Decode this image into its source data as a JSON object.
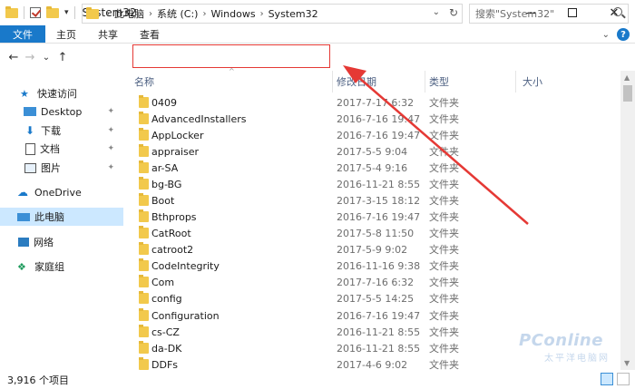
{
  "window": {
    "title": "System32",
    "min_icon": "minimize-icon",
    "max_icon": "maximize-icon",
    "close_glyph": "✕"
  },
  "ribbon": {
    "tabs": [
      "文件",
      "主页",
      "共享",
      "查看"
    ],
    "expand_glyph": "⌄",
    "help_glyph": "?"
  },
  "nav": {
    "back": "←",
    "forward": "→",
    "recent": "⌄",
    "up": "↑"
  },
  "address": {
    "crumbs": [
      "此电脑",
      "系统 (C:)",
      "Windows",
      "System32"
    ],
    "sep": "›",
    "dropdown": "⌄",
    "refresh": "↻"
  },
  "search": {
    "placeholder": "搜索\"System32\""
  },
  "sidebar": {
    "items": [
      {
        "label": "快速访问",
        "icon": "star-icon"
      },
      {
        "label": "Desktop",
        "icon": "desktop-icon",
        "pinned": true
      },
      {
        "label": "下载",
        "icon": "download-icon",
        "pinned": true
      },
      {
        "label": "文档",
        "icon": "document-icon",
        "pinned": true
      },
      {
        "label": "图片",
        "icon": "picture-icon",
        "pinned": true
      },
      {
        "label": "OneDrive",
        "icon": "cloud-icon"
      },
      {
        "label": "此电脑",
        "icon": "computer-icon",
        "selected": true
      },
      {
        "label": "网络",
        "icon": "network-icon"
      },
      {
        "label": "家庭组",
        "icon": "homegroup-icon"
      }
    ]
  },
  "columns": {
    "name": "名称",
    "date": "修改日期",
    "type": "类型",
    "size": "大小"
  },
  "files": [
    {
      "name": "0409",
      "date": "2017-7-17 6:32",
      "type": "文件夹"
    },
    {
      "name": "AdvancedInstallers",
      "date": "2016-7-16 19:47",
      "type": "文件夹"
    },
    {
      "name": "AppLocker",
      "date": "2016-7-16 19:47",
      "type": "文件夹"
    },
    {
      "name": "appraiser",
      "date": "2017-5-5 9:04",
      "type": "文件夹"
    },
    {
      "name": "ar-SA",
      "date": "2017-5-4 9:16",
      "type": "文件夹"
    },
    {
      "name": "bg-BG",
      "date": "2016-11-21 8:55",
      "type": "文件夹"
    },
    {
      "name": "Boot",
      "date": "2017-3-15 18:12",
      "type": "文件夹"
    },
    {
      "name": "Bthprops",
      "date": "2016-7-16 19:47",
      "type": "文件夹"
    },
    {
      "name": "CatRoot",
      "date": "2017-5-8 11:50",
      "type": "文件夹"
    },
    {
      "name": "catroot2",
      "date": "2017-5-9 9:02",
      "type": "文件夹"
    },
    {
      "name": "CodeIntegrity",
      "date": "2016-11-16 9:38",
      "type": "文件夹"
    },
    {
      "name": "Com",
      "date": "2017-7-16 6:32",
      "type": "文件夹"
    },
    {
      "name": "config",
      "date": "2017-5-5 14:25",
      "type": "文件夹"
    },
    {
      "name": "Configuration",
      "date": "2016-7-16 19:47",
      "type": "文件夹"
    },
    {
      "name": "cs-CZ",
      "date": "2016-11-21 8:55",
      "type": "文件夹"
    },
    {
      "name": "da-DK",
      "date": "2016-11-21 8:55",
      "type": "文件夹"
    },
    {
      "name": "DDFs",
      "date": "2017-4-6 9:02",
      "type": "文件夹"
    }
  ],
  "status": {
    "count": "3,916 个项目"
  },
  "colors": {
    "accent": "#1979ca",
    "selected": "#cce8ff",
    "annotation": "#e53935"
  },
  "watermark": {
    "brand": "PConline",
    "sub": "太平洋电脑网"
  }
}
